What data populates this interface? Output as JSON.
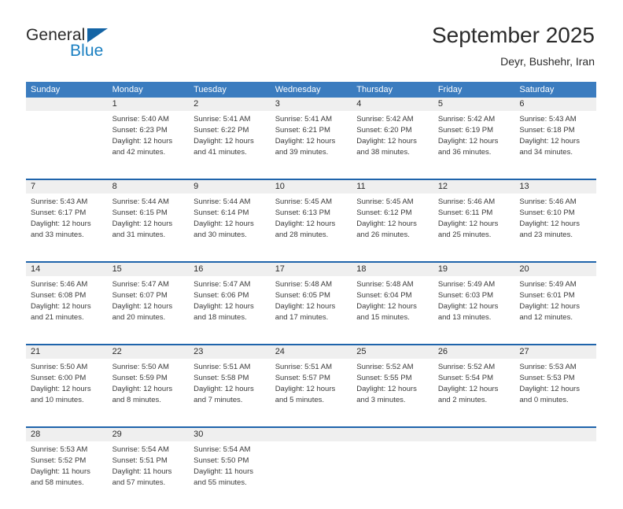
{
  "logo": {
    "name": "general-blue-logo",
    "text_primary": "General",
    "text_secondary": "Blue",
    "triangle_color": "#1464a5",
    "secondary_color": "#1a7fc1"
  },
  "header": {
    "title": "September 2025",
    "subtitle": "Deyr, Bushehr, Iran"
  },
  "colors": {
    "header_bar": "#3b7cbf",
    "row_divider": "#1f64ab",
    "daynum_band": "#efefef",
    "text": "#2b2b2b"
  },
  "weekdays": [
    "Sunday",
    "Monday",
    "Tuesday",
    "Wednesday",
    "Thursday",
    "Friday",
    "Saturday"
  ],
  "weeks": [
    [
      {
        "day": "",
        "lines": []
      },
      {
        "day": "1",
        "lines": [
          "Sunrise: 5:40 AM",
          "Sunset: 6:23 PM",
          "Daylight: 12 hours",
          "and 42 minutes."
        ]
      },
      {
        "day": "2",
        "lines": [
          "Sunrise: 5:41 AM",
          "Sunset: 6:22 PM",
          "Daylight: 12 hours",
          "and 41 minutes."
        ]
      },
      {
        "day": "3",
        "lines": [
          "Sunrise: 5:41 AM",
          "Sunset: 6:21 PM",
          "Daylight: 12 hours",
          "and 39 minutes."
        ]
      },
      {
        "day": "4",
        "lines": [
          "Sunrise: 5:42 AM",
          "Sunset: 6:20 PM",
          "Daylight: 12 hours",
          "and 38 minutes."
        ]
      },
      {
        "day": "5",
        "lines": [
          "Sunrise: 5:42 AM",
          "Sunset: 6:19 PM",
          "Daylight: 12 hours",
          "and 36 minutes."
        ]
      },
      {
        "day": "6",
        "lines": [
          "Sunrise: 5:43 AM",
          "Sunset: 6:18 PM",
          "Daylight: 12 hours",
          "and 34 minutes."
        ]
      }
    ],
    [
      {
        "day": "7",
        "lines": [
          "Sunrise: 5:43 AM",
          "Sunset: 6:17 PM",
          "Daylight: 12 hours",
          "and 33 minutes."
        ]
      },
      {
        "day": "8",
        "lines": [
          "Sunrise: 5:44 AM",
          "Sunset: 6:15 PM",
          "Daylight: 12 hours",
          "and 31 minutes."
        ]
      },
      {
        "day": "9",
        "lines": [
          "Sunrise: 5:44 AM",
          "Sunset: 6:14 PM",
          "Daylight: 12 hours",
          "and 30 minutes."
        ]
      },
      {
        "day": "10",
        "lines": [
          "Sunrise: 5:45 AM",
          "Sunset: 6:13 PM",
          "Daylight: 12 hours",
          "and 28 minutes."
        ]
      },
      {
        "day": "11",
        "lines": [
          "Sunrise: 5:45 AM",
          "Sunset: 6:12 PM",
          "Daylight: 12 hours",
          "and 26 minutes."
        ]
      },
      {
        "day": "12",
        "lines": [
          "Sunrise: 5:46 AM",
          "Sunset: 6:11 PM",
          "Daylight: 12 hours",
          "and 25 minutes."
        ]
      },
      {
        "day": "13",
        "lines": [
          "Sunrise: 5:46 AM",
          "Sunset: 6:10 PM",
          "Daylight: 12 hours",
          "and 23 minutes."
        ]
      }
    ],
    [
      {
        "day": "14",
        "lines": [
          "Sunrise: 5:46 AM",
          "Sunset: 6:08 PM",
          "Daylight: 12 hours",
          "and 21 minutes."
        ]
      },
      {
        "day": "15",
        "lines": [
          "Sunrise: 5:47 AM",
          "Sunset: 6:07 PM",
          "Daylight: 12 hours",
          "and 20 minutes."
        ]
      },
      {
        "day": "16",
        "lines": [
          "Sunrise: 5:47 AM",
          "Sunset: 6:06 PM",
          "Daylight: 12 hours",
          "and 18 minutes."
        ]
      },
      {
        "day": "17",
        "lines": [
          "Sunrise: 5:48 AM",
          "Sunset: 6:05 PM",
          "Daylight: 12 hours",
          "and 17 minutes."
        ]
      },
      {
        "day": "18",
        "lines": [
          "Sunrise: 5:48 AM",
          "Sunset: 6:04 PM",
          "Daylight: 12 hours",
          "and 15 minutes."
        ]
      },
      {
        "day": "19",
        "lines": [
          "Sunrise: 5:49 AM",
          "Sunset: 6:03 PM",
          "Daylight: 12 hours",
          "and 13 minutes."
        ]
      },
      {
        "day": "20",
        "lines": [
          "Sunrise: 5:49 AM",
          "Sunset: 6:01 PM",
          "Daylight: 12 hours",
          "and 12 minutes."
        ]
      }
    ],
    [
      {
        "day": "21",
        "lines": [
          "Sunrise: 5:50 AM",
          "Sunset: 6:00 PM",
          "Daylight: 12 hours",
          "and 10 minutes."
        ]
      },
      {
        "day": "22",
        "lines": [
          "Sunrise: 5:50 AM",
          "Sunset: 5:59 PM",
          "Daylight: 12 hours",
          "and 8 minutes."
        ]
      },
      {
        "day": "23",
        "lines": [
          "Sunrise: 5:51 AM",
          "Sunset: 5:58 PM",
          "Daylight: 12 hours",
          "and 7 minutes."
        ]
      },
      {
        "day": "24",
        "lines": [
          "Sunrise: 5:51 AM",
          "Sunset: 5:57 PM",
          "Daylight: 12 hours",
          "and 5 minutes."
        ]
      },
      {
        "day": "25",
        "lines": [
          "Sunrise: 5:52 AM",
          "Sunset: 5:55 PM",
          "Daylight: 12 hours",
          "and 3 minutes."
        ]
      },
      {
        "day": "26",
        "lines": [
          "Sunrise: 5:52 AM",
          "Sunset: 5:54 PM",
          "Daylight: 12 hours",
          "and 2 minutes."
        ]
      },
      {
        "day": "27",
        "lines": [
          "Sunrise: 5:53 AM",
          "Sunset: 5:53 PM",
          "Daylight: 12 hours",
          "and 0 minutes."
        ]
      }
    ],
    [
      {
        "day": "28",
        "lines": [
          "Sunrise: 5:53 AM",
          "Sunset: 5:52 PM",
          "Daylight: 11 hours",
          "and 58 minutes."
        ]
      },
      {
        "day": "29",
        "lines": [
          "Sunrise: 5:54 AM",
          "Sunset: 5:51 PM",
          "Daylight: 11 hours",
          "and 57 minutes."
        ]
      },
      {
        "day": "30",
        "lines": [
          "Sunrise: 5:54 AM",
          "Sunset: 5:50 PM",
          "Daylight: 11 hours",
          "and 55 minutes."
        ]
      },
      {
        "day": "",
        "lines": []
      },
      {
        "day": "",
        "lines": []
      },
      {
        "day": "",
        "lines": []
      },
      {
        "day": "",
        "lines": []
      }
    ]
  ]
}
